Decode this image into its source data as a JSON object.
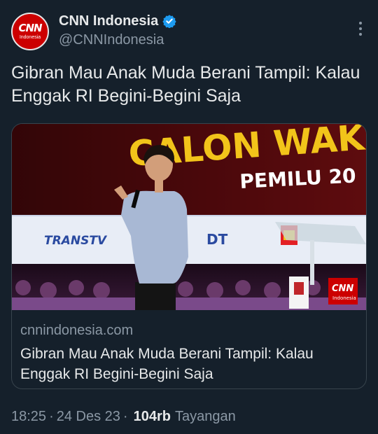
{
  "account": {
    "display_name": "CNN Indonesia",
    "handle": "@CNNIndonesia",
    "avatar_logo": "CNN",
    "avatar_sub": "Indonesia",
    "verified_color": "#1d9bf0"
  },
  "tweet": {
    "text": "Gibran Mau Anak Muda Berani Tampil: Kalau Enggak RI Begini-Begini Saja"
  },
  "card": {
    "image": {
      "banner_line1": "CALON WAKIL P",
      "banner_line2": "PEMILU 20",
      "sponsor_logo": "TRANSTV",
      "partner_logo": "DT",
      "watermark_logo": "CNN",
      "watermark_sub": "Indonesia"
    },
    "domain": "cnnindonesia.com",
    "title": "Gibran Mau Anak Muda Berani Tampil: Kalau Enggak RI Begini-Begini Saja"
  },
  "meta": {
    "time": "18:25",
    "separator": "·",
    "date": "24 Des 23",
    "views_count": "104rb",
    "views_label": "Tayangan"
  }
}
